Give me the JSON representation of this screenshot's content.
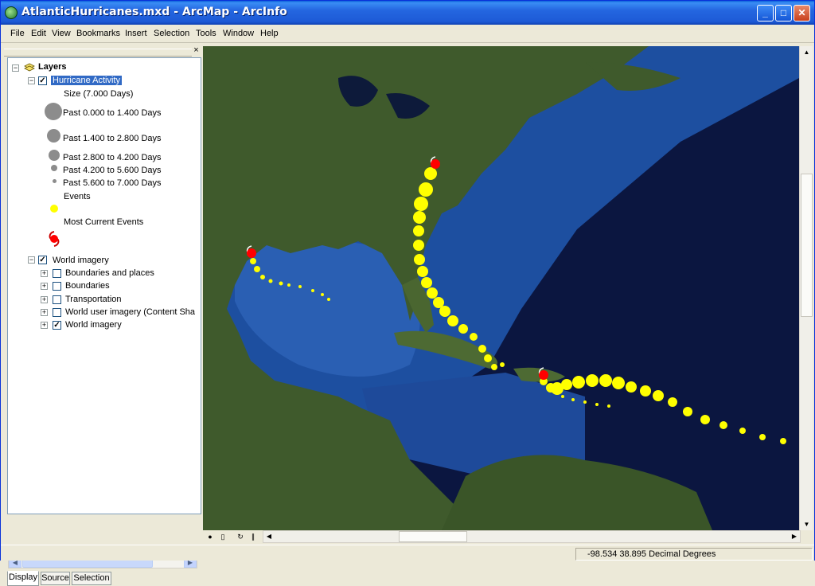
{
  "window": {
    "title": "AtlanticHurricanes.mxd - ArcMap - ArcInfo",
    "minimize_label": "_",
    "maximize_label": "□",
    "close_label": "✕"
  },
  "menubar": {
    "items": [
      "File",
      "Edit",
      "View",
      "Bookmarks",
      "Insert",
      "Selection",
      "Tools",
      "Window",
      "Help"
    ]
  },
  "toc": {
    "close_label": "×",
    "root_label": "Layers",
    "layers": [
      {
        "name": "Hurricane Activity",
        "checked": true,
        "expanded": true,
        "selected": true,
        "legend": {
          "heading": "Size (7.000 Days)",
          "classes": [
            "Past 0.000 to 1.400 Days",
            "Past 1.400 to 2.800 Days",
            "Past 2.800 to 4.200 Days",
            "Past 4.200 to 5.600 Days",
            "Past 5.600 to 7.000 Days"
          ],
          "events_label": "Events",
          "current_label": "Most Current Events"
        }
      },
      {
        "name": "World imagery",
        "checked": true,
        "expanded": true,
        "sublayers": [
          {
            "name": "Boundaries and places",
            "checked": false
          },
          {
            "name": "Boundaries",
            "checked": false
          },
          {
            "name": "Transportation",
            "checked": false
          },
          {
            "name": "World user imagery (Content Sha",
            "checked": false
          },
          {
            "name": "World imagery",
            "checked": true
          }
        ]
      }
    ],
    "tabs": [
      "Display",
      "Source",
      "Selection"
    ],
    "active_tab": "Display"
  },
  "map": {
    "colors": {
      "track": "#ffff00",
      "current": "#ff0000",
      "ocean_deep": "#0b1640",
      "ocean_shelf": "#1d4fa0",
      "land": "#3f5a2c"
    }
  },
  "statusbar": {
    "coordinates": "-98.534  38.895 Decimal Degrees"
  }
}
